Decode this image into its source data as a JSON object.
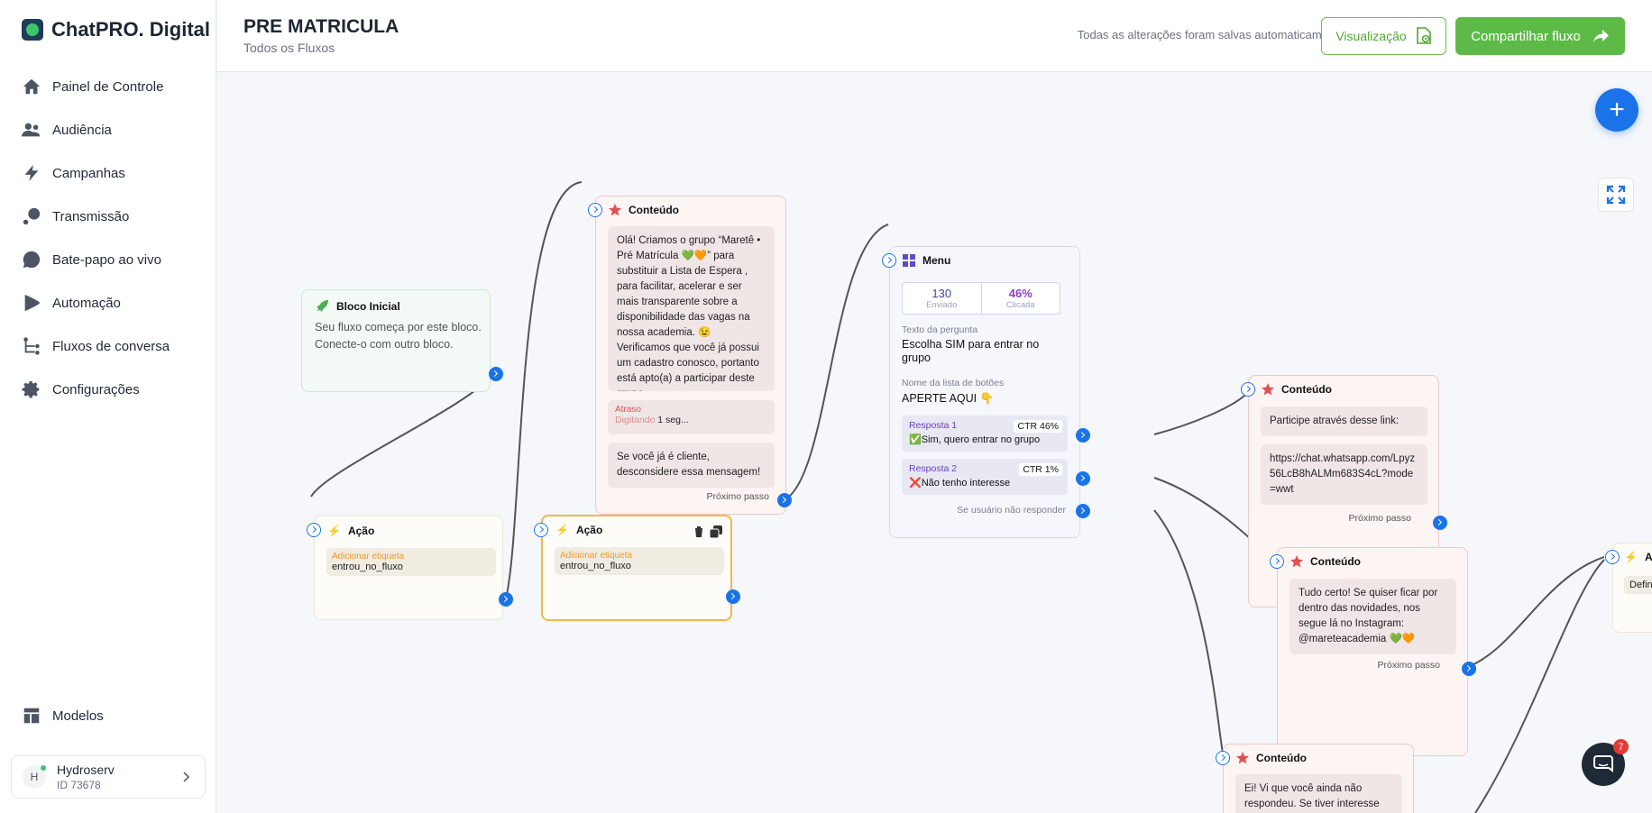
{
  "app": {
    "name": "ChatPRO. Digital"
  },
  "nav": {
    "items": [
      {
        "label": "Painel de Controle",
        "icon": "home-icon"
      },
      {
        "label": "Audiência",
        "icon": "users-icon"
      },
      {
        "label": "Campanhas",
        "icon": "campaign-icon"
      },
      {
        "label": "Transmissão",
        "icon": "broadcast-icon"
      },
      {
        "label": "Bate-papo ao vivo",
        "icon": "chat-icon"
      },
      {
        "label": "Automação",
        "icon": "automation-icon"
      },
      {
        "label": "Fluxos de conversa",
        "icon": "flow-icon"
      },
      {
        "label": "Configurações",
        "icon": "gear-icon"
      }
    ],
    "bottom": {
      "label": "Modelos",
      "icon": "templates-icon"
    }
  },
  "account": {
    "initial": "H",
    "name": "Hydroserv",
    "id": "ID 73678"
  },
  "header": {
    "title": "PRE MATRICULA",
    "subtitle": "Todos os Fluxos",
    "saved_status": "Todas as alterações foram salvas automaticamente",
    "view_label": "Visualização",
    "share_label": "Compartilhar fluxo"
  },
  "chat_widget": {
    "badge": "7"
  },
  "nodes": {
    "start": {
      "title": "Bloco Inicial",
      "text": "Seu fluxo começa por este bloco. Conecte-o com outro bloco."
    },
    "action1": {
      "title": "Ação",
      "tag_label": "Adicionar etiqueta",
      "tag_value": "entrou_no_fluxo"
    },
    "action2": {
      "title": "Ação",
      "tag_label": "Adicionar etiqueta",
      "tag_value": "entrou_no_fluxo"
    },
    "content1": {
      "title": "Conteúdo",
      "message": "Olá! Criamos o grupo “Maretê • Pré Matrícula 💚🧡” para substituir a Lista de Espera , para facilitar, acelerar e ser mais transparente sobre a disponibilidade das vagas na nossa academia. 😉 Verificamos que você já possui um cadastro conosco, portanto está apto(a) a participar deste grupo.",
      "delay_label": "Atraso",
      "typing_label": "Digitando",
      "typing_value": "1 seg...",
      "message2": "Se você já é cliente, desconsidere essa mensagem!",
      "next": "Próximo passo"
    },
    "menu": {
      "title": "Menu",
      "sent_value": "130",
      "sent_label": "Enviado",
      "click_value": "46%",
      "click_label": "Clicada",
      "question_label": "Texto da pergunta",
      "question_value": "Escolha SIM para entrar no grupo",
      "buttons_label": "Nome da lista de botões",
      "buttons_value": "APERTE AQUI 👇",
      "responses": [
        {
          "label": "Resposta 1",
          "ctr": "CTR 46%",
          "text": "✅Sim, quero entrar no grupo"
        },
        {
          "label": "Resposta 2",
          "ctr": "CTR 1%",
          "text": "❌Não tenho interesse"
        }
      ],
      "no_reply": "Se usuário não responder"
    },
    "content2": {
      "title": "Conteúdo",
      "message": "Participe através desse link:",
      "link": "https://chat.whatsapp.com/Lpyz56LcB8hALMm683S4cL?mode=wwt",
      "next": "Próximo passo"
    },
    "content3": {
      "title": "Conteúdo",
      "message": "Tudo certo! Se quiser ficar por dentro das novidades, nos segue lá no Instagram: @mareteacademia 💚🧡",
      "next": "Próximo passo"
    },
    "content4": {
      "title": "Conteúdo",
      "message": "Ei! Vi que você ainda não respondeu. Se tiver interesse em e"
    },
    "action3": {
      "title": "A",
      "text": "Defin"
    }
  },
  "colors": {
    "accent": "#1a73e8",
    "brand_green": "#5dba47",
    "content_red": "#e05252",
    "action_yellow": "#f0b84a",
    "menu_purple": "#5b4fc7"
  }
}
